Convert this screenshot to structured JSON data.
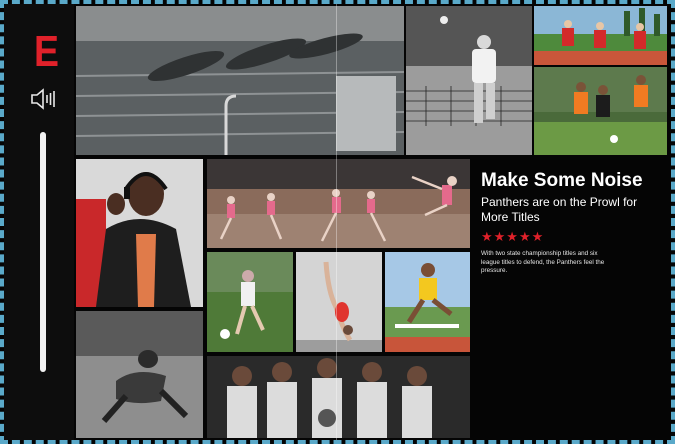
{
  "logo": {
    "letter": "E"
  },
  "volume": {
    "icon": "volume-icon",
    "level": 1.0
  },
  "feature": {
    "title": "Make Some Noise",
    "subtitle": "Panthers are on the Prowl for More Titles",
    "rating": "★★★★★",
    "description": "With two state championship titles and six league titles to defend, the Panthers feel the pressure."
  },
  "colors": {
    "accent": "#e0212a",
    "background": "#050505",
    "border": "#5aa9c9"
  }
}
